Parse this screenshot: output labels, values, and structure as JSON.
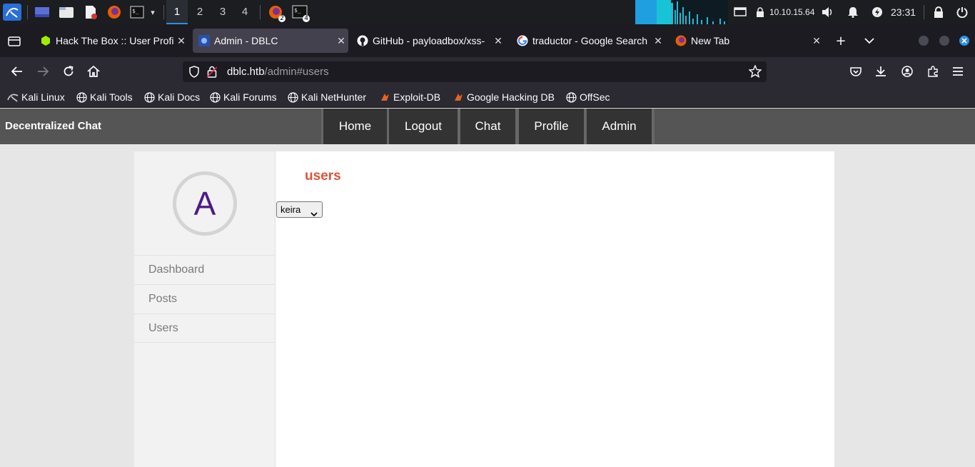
{
  "taskbar": {
    "workspaces": [
      "1",
      "2",
      "3",
      "4"
    ],
    "firefox_badge": "2",
    "terminal_badge": "4",
    "ip": "10.10.15.64",
    "clock": "23:31"
  },
  "browser": {
    "tabs": [
      {
        "title": "Hack The Box :: User Profi",
        "icon": "htb-icon",
        "active": false
      },
      {
        "title": "Admin - DBLC",
        "icon": "dblc-icon",
        "active": true
      },
      {
        "title": "GitHub - payloadbox/xss-",
        "icon": "github-icon",
        "active": false
      },
      {
        "title": "traductor - Google Search",
        "icon": "google-icon",
        "active": false
      },
      {
        "title": "New Tab",
        "icon": "firefox-icon",
        "active": false
      }
    ],
    "url_host": "dblc.htb",
    "url_path": "/admin#users",
    "bookmarks": [
      "Kali Linux",
      "Kali Tools",
      "Kali Docs",
      "Kali Forums",
      "Kali NetHunter",
      "Exploit-DB",
      "Google Hacking DB",
      "OffSec"
    ]
  },
  "site": {
    "brand": "Decentralized Chat",
    "nav": [
      "Home",
      "Logout",
      "Chat",
      "Profile",
      "Admin"
    ],
    "avatar_letter": "A",
    "sidebar": [
      "Dashboard",
      "Posts",
      "Users"
    ],
    "section_title": "users",
    "user_select_value": "keira"
  }
}
